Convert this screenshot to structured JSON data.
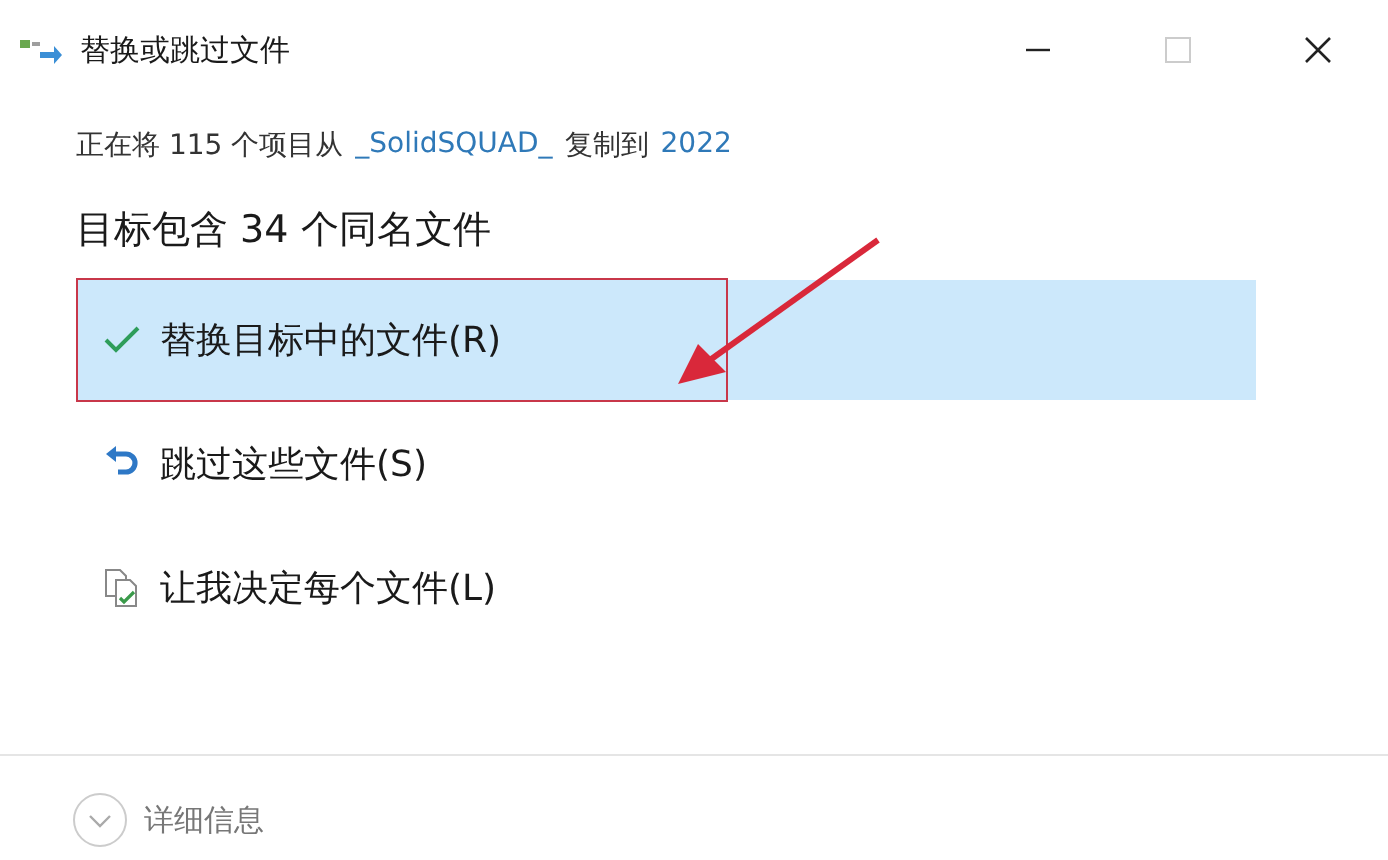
{
  "window": {
    "title": "替换或跳过文件"
  },
  "copy_line": {
    "prefix": "正在将 115 个项目从",
    "source": "_SolidSQUAD_",
    "middle": "复制到",
    "destination": "2022"
  },
  "heading": "目标包含 34 个同名文件",
  "options": [
    {
      "kind": "replace",
      "label": "替换目标中的文件(R)",
      "selected": true,
      "annotated": true
    },
    {
      "kind": "skip",
      "label": "跳过这些文件(S)",
      "selected": false,
      "annotated": false
    },
    {
      "kind": "decide",
      "label": "让我决定每个文件(L)",
      "selected": false,
      "annotated": false
    }
  ],
  "footer": {
    "label": "详细信息",
    "expanded": false
  }
}
